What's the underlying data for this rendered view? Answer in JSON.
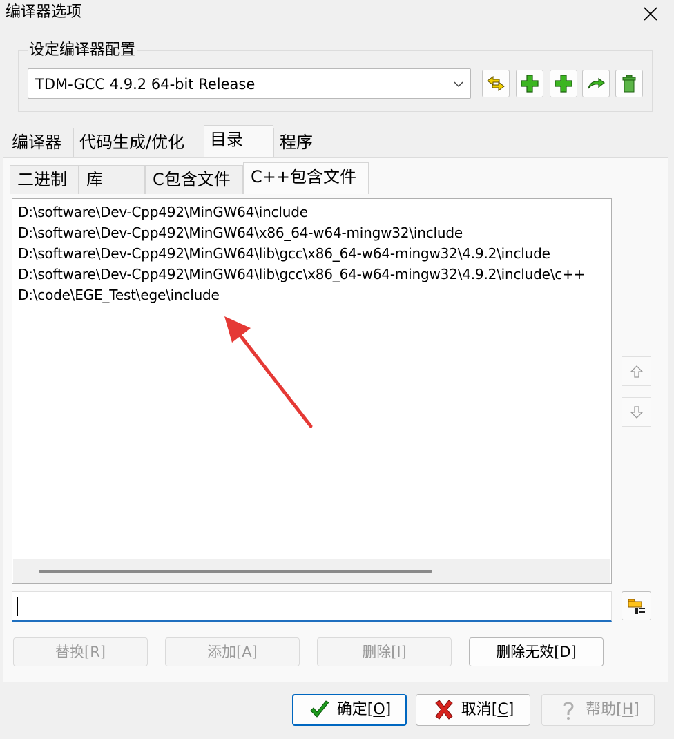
{
  "window": {
    "title": "编译器选项"
  },
  "compiler_set": {
    "group_title": "设定编译器配置",
    "selected": "TDM-GCC 4.9.2 64-bit Release"
  },
  "main_tabs": [
    {
      "label": "编译器"
    },
    {
      "label": "代码生成/优化"
    },
    {
      "label": "目录"
    },
    {
      "label": "程序"
    }
  ],
  "dir_tabs": [
    {
      "label": "二进制"
    },
    {
      "label": "库"
    },
    {
      "label": "C包含文件"
    },
    {
      "label": "C++包含文件"
    }
  ],
  "include_dirs": [
    "D:\\software\\Dev-Cpp492\\MinGW64\\include",
    "D:\\software\\Dev-Cpp492\\MinGW64\\x86_64-w64-mingw32\\include",
    "D:\\software\\Dev-Cpp492\\MinGW64\\lib\\gcc\\x86_64-w64-mingw32\\4.9.2\\include",
    "D:\\software\\Dev-Cpp492\\MinGW64\\lib\\gcc\\x86_64-w64-mingw32\\4.9.2\\include\\c++",
    "D:\\code\\EGE_Test\\ege\\include"
  ],
  "path_input": {
    "value": ""
  },
  "actions": {
    "replace": "替换[R]",
    "add": "添加[A]",
    "delete": "删除[I]",
    "delete_invalid": "删除无效[D]"
  },
  "dialog_buttons": {
    "ok_prefix": "确定[",
    "ok_key": "O",
    "ok_suffix": "]",
    "cancel_prefix": "取消[",
    "cancel_key": "C",
    "cancel_suffix": "]",
    "help_prefix": "帮助[",
    "help_key": "H",
    "help_suffix": "]"
  },
  "colors": {
    "accent": "#0067c0",
    "arrow": "#e53935"
  }
}
